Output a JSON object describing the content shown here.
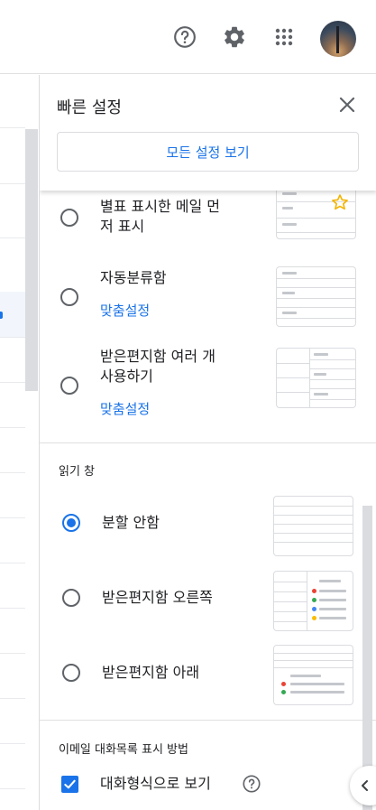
{
  "topbar": {
    "help_icon": "help-circle-icon",
    "settings_icon": "gear-icon",
    "apps_icon": "apps-grid-icon",
    "avatar": "account-avatar"
  },
  "quick_settings": {
    "title": "빠른 설정",
    "all_settings_label": "모든 설정 보기",
    "inbox_options": [
      {
        "label_line1": "별표 표시한 메일 먼",
        "label_line2": "저 표시"
      },
      {
        "label": "자동분류함",
        "link": "맞춤설정"
      },
      {
        "label_line1": "받은편지함 여러 개",
        "label_line2": "사용하기",
        "link": "맞춤설정"
      }
    ],
    "reading_pane": {
      "title": "읽기 창",
      "options": [
        {
          "label": "분할 안함",
          "checked": true
        },
        {
          "label": "받은편지함 오른쪽",
          "checked": false
        },
        {
          "label": "받은편지함 아래",
          "checked": false
        }
      ]
    },
    "threading": {
      "title": "이메일 대화목록 표시 방법",
      "checkbox_label": "대화형식으로 보기",
      "checked": true
    }
  },
  "colors": {
    "accent": "#1a73e8",
    "star": "#f4b400",
    "dot_red": "#ea4335",
    "dot_green": "#34a853",
    "dot_blue": "#4285f4",
    "dot_yellow": "#fbbc04"
  }
}
